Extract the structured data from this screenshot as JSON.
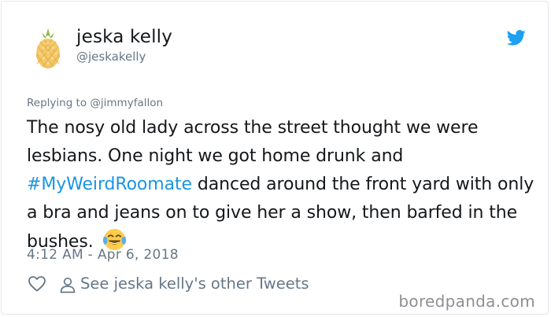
{
  "author": {
    "display_name": "jeska kelly",
    "handle": "@jeskakelly",
    "avatar_icon": "pineapple-avatar"
  },
  "reply": {
    "prefix": "Replying to ",
    "mention": "@jimmyfallon"
  },
  "tweet": {
    "text_1": "The nosy old lady across the street thought we were lesbians. One night we got home drunk and ",
    "hashtag": "#MyWeirdRoomate",
    "text_2": " danced around the front yard with only a bra and jeans on to give her a show, then barfed in the bushes. ",
    "emoji_icon": "face-with-tears-of-joy-icon"
  },
  "timestamp": "4:12 AM - Apr 6, 2018",
  "actions": {
    "like_icon": "heart-icon",
    "profile_icon": "person-icon",
    "other_tweets_label": "See jeska kelly's other Tweets"
  },
  "brand": {
    "logo_icon": "twitter-bird-icon",
    "accent": "#1da1f2",
    "link": "#1b95e0"
  },
  "watermark": "boredpanda.com"
}
